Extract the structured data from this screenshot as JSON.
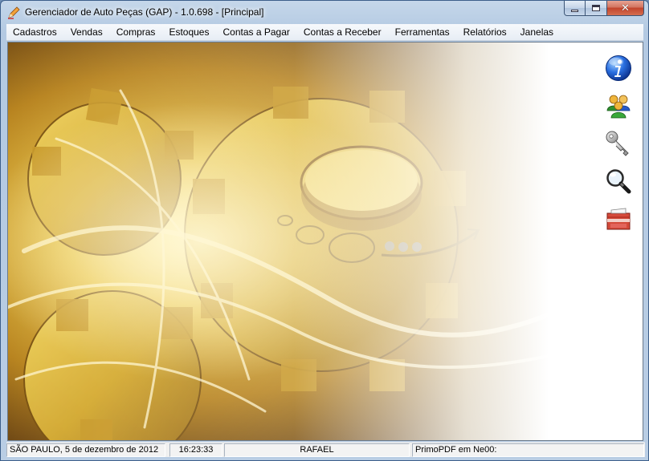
{
  "window": {
    "title": "Gerenciador de Auto Peças (GAP) - 1.0.698 - [Principal]",
    "icon": "pencil-icon",
    "controls": {
      "minimize": "minimize-icon",
      "maximize": "maximize-icon",
      "close": "✕"
    }
  },
  "menu": {
    "items": [
      "Cadastros",
      "Vendas",
      "Compras",
      "Estoques",
      "Contas a Pagar",
      "Contas a Receber",
      "Ferramentas",
      "Relatórios",
      "Janelas"
    ]
  },
  "sidebar": {
    "icons": [
      "info-icon",
      "users-icon",
      "key-icon",
      "magnifier-icon",
      "exit-icon"
    ]
  },
  "status": {
    "location_date": "SÃO PAULO, 5 de dezembro de 2012",
    "time": "16:23:33",
    "user": "RAFAEL",
    "printer": "PrimoPDF em Ne00:"
  },
  "colors": {
    "wallpaper_gold": "#d9b63a",
    "wallpaper_dark": "#5a3a12",
    "info_blue": "#1f5fd8",
    "close_red": "#c2442c"
  }
}
